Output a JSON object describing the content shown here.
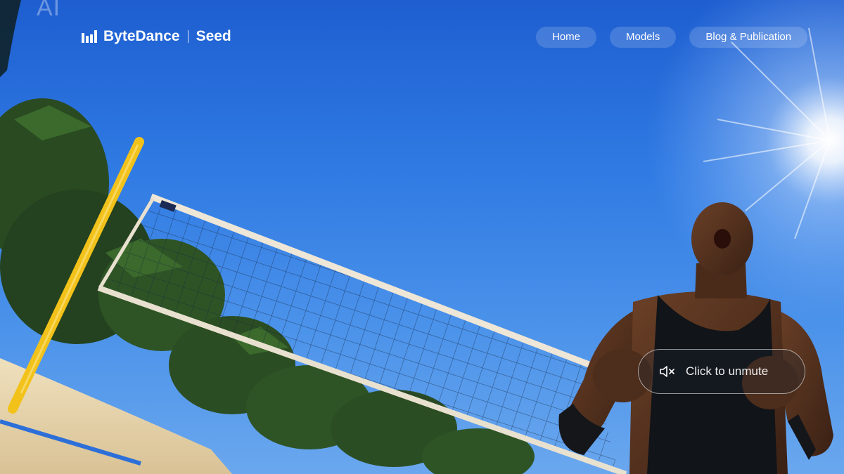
{
  "watermark": "AI",
  "brand": {
    "name": "ByteDance",
    "product": "Seed",
    "icon": "bytedance-logo-icon"
  },
  "nav": {
    "items": [
      {
        "label": "Home"
      },
      {
        "label": "Models"
      },
      {
        "label": "Blog & Publication"
      }
    ]
  },
  "video": {
    "unmute_label": "Click to unmute",
    "unmute_icon": "speaker-muted-icon",
    "scene": "beach-volleyball-player"
  },
  "colors": {
    "sky": "#2f7ae3",
    "sand": "#e8d6b0",
    "pole": "#f2c21a",
    "text": "#ffffff"
  }
}
